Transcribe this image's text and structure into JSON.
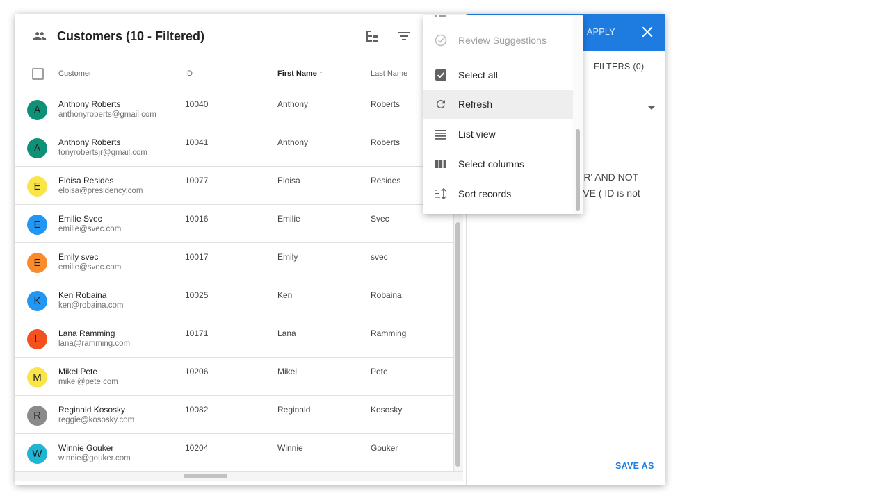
{
  "list": {
    "title": "Customers (10 - Filtered)",
    "columns": {
      "customer": "Customer",
      "id": "ID",
      "first_name": "First Name",
      "sort_arrow": "↑",
      "last_name": "Last Name"
    },
    "rows": [
      {
        "initial": "A",
        "color": "#0e9177",
        "name": "Anthony Roberts",
        "email": "anthonyroberts@gmail.com",
        "id": "10040",
        "first": "Anthony",
        "last": "Roberts"
      },
      {
        "initial": "A",
        "color": "#0e9177",
        "name": "Anthony Roberts",
        "email": "tonyrobertsjr@gmail.com",
        "id": "10041",
        "first": "Anthony",
        "last": "Roberts"
      },
      {
        "initial": "E",
        "color": "#f9e547",
        "name": "Eloisa Resides",
        "email": "eloisa@presidency.com",
        "id": "10077",
        "first": "Eloisa",
        "last": "Resides"
      },
      {
        "initial": "E",
        "color": "#2196f3",
        "name": "Emilie Svec",
        "email": "emilie@svec.com",
        "id": "10016",
        "first": "Emilie",
        "last": "Svec"
      },
      {
        "initial": "E",
        "color": "#f98b2b",
        "name": "Emily svec",
        "email": "emilie@svec.com",
        "id": "10017",
        "first": "Emily",
        "last": "svec"
      },
      {
        "initial": "K",
        "color": "#2196f3",
        "name": "Ken Robaina",
        "email": "ken@robaina.com",
        "id": "10025",
        "first": "Ken",
        "last": "Robaina"
      },
      {
        "initial": "L",
        "color": "#f4511e",
        "name": "Lana Ramming",
        "email": "lana@ramming.com",
        "id": "10171",
        "first": "Lana",
        "last": "Ramming"
      },
      {
        "initial": "M",
        "color": "#f9e547",
        "name": "Mikel Pete",
        "email": "mikel@pete.com",
        "id": "10206",
        "first": "Mikel",
        "last": "Pete"
      },
      {
        "initial": "R",
        "color": "#8a8a8a",
        "name": "Reginald Kososky",
        "email": "reggie@kososky.com",
        "id": "10082",
        "first": "Reginald",
        "last": "Kososky"
      },
      {
        "initial": "W",
        "color": "#1fb5d4",
        "name": "Winnie Gouker",
        "email": "winnie@gouker.com",
        "id": "10204",
        "first": "Winnie",
        "last": "Gouker"
      }
    ]
  },
  "filter_panel": {
    "apply_label": "APPLY",
    "filters_tab": "FILTERS (0)",
    "query_line1": "ER' AND NOT",
    "query_line2": "AVE ( ID is not",
    "save_as_label": "SAVE AS",
    "accent_color": "#1e7be0"
  },
  "menu": {
    "items": [
      {
        "label": "Review Suggestions",
        "icon": "check-circle-icon",
        "disabled": true
      },
      {
        "label": "Select all",
        "icon": "checkbox-checked-icon"
      },
      {
        "label": "Refresh",
        "icon": "refresh-icon",
        "active": true
      },
      {
        "label": "List view",
        "icon": "list-view-icon"
      },
      {
        "label": "Select columns",
        "icon": "columns-icon"
      },
      {
        "label": "Sort records",
        "icon": "sort-icon"
      }
    ]
  }
}
